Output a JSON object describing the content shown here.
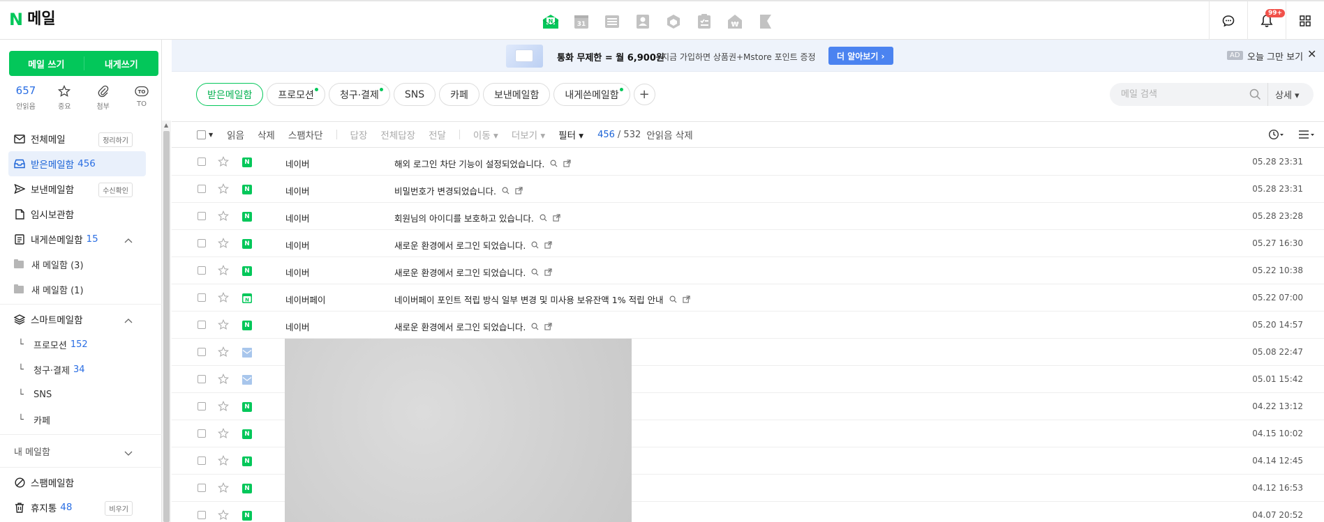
{
  "header": {
    "logo_mark": "N",
    "logo_text": "메일",
    "apps": [
      "mail-app",
      "calendar-app",
      "contacts-list-app",
      "address-book-app",
      "drive-box-app",
      "todo-app",
      "pay-app",
      "bookmark-app"
    ],
    "notification_badge": "99+",
    "calendar_day": "31"
  },
  "sidebar": {
    "write_mail": "메일 쓰기",
    "write_self": "내게쓰기",
    "quick": [
      {
        "value": "657",
        "label": "안읽음"
      },
      {
        "label": "중요"
      },
      {
        "label": "첨부"
      },
      {
        "label": "TO",
        "icon_text": "TO"
      }
    ],
    "items": [
      {
        "label": "전체메일",
        "tag": "정리하기"
      },
      {
        "label": "받은메일함",
        "count": "456"
      },
      {
        "label": "보낸메일함",
        "tag": "수신확인"
      },
      {
        "label": "임시보관함"
      },
      {
        "label": "내게쓴메일함",
        "count": "15"
      }
    ],
    "subfolders": [
      {
        "label": "새 메일함 (3)"
      },
      {
        "label": "새 메일함 (1)"
      }
    ],
    "smart": {
      "label": "스마트메일함",
      "children": [
        {
          "label": "프로모션",
          "count": "152"
        },
        {
          "label": "청구·결제",
          "count": "34"
        },
        {
          "label": "SNS"
        },
        {
          "label": "카페"
        }
      ]
    },
    "my_mailbox": "내 메일함",
    "spam": "스팸메일함",
    "trash": {
      "label": "휴지통",
      "count": "48",
      "tag": "비우기"
    }
  },
  "ad": {
    "title": "통화 무제한 = 월 6,900원",
    "subtitle": "지금 가입하면 상품권+Mstore 포인트 증정",
    "cta": "더 알아보기 ›",
    "tag": "AD",
    "dismiss": "오늘 그만 보기",
    "close": "✕"
  },
  "tabs": [
    {
      "label": "받은메일함"
    },
    {
      "label": "프로모션"
    },
    {
      "label": "청구·결제"
    },
    {
      "label": "SNS"
    },
    {
      "label": "카페"
    },
    {
      "label": "보낸메일함"
    },
    {
      "label": "내게쓴메일함"
    }
  ],
  "search": {
    "placeholder": "메일 검색",
    "detail": "상세 ▾"
  },
  "toolbar": {
    "read": "읽음",
    "delete": "삭제",
    "spam_block": "스팸차단",
    "reply": "답장",
    "reply_all": "전체답장",
    "forward": "전달",
    "move": "이동 ▾",
    "more": "더보기 ▾",
    "filter": "필터 ▾",
    "count_unread": "456",
    "count_total": "/ 532",
    "delete_unread": "안읽음 삭제"
  },
  "mails": [
    {
      "sender": "네이버",
      "subject": "해외 로그인 차단 기능이 설정되었습니다.",
      "date": "05.28 23:31",
      "icon": "naver"
    },
    {
      "sender": "네이버",
      "subject": "비밀번호가 변경되었습니다.",
      "date": "05.28 23:31",
      "icon": "naver"
    },
    {
      "sender": "네이버",
      "subject": "회원님의 아이디를 보호하고 있습니다.",
      "date": "05.28 23:28",
      "icon": "naver"
    },
    {
      "sender": "네이버",
      "subject": "새로운 환경에서 로그인 되었습니다.",
      "date": "05.27 16:30",
      "icon": "naver"
    },
    {
      "sender": "네이버",
      "subject": "새로운 환경에서 로그인 되었습니다.",
      "date": "05.22 10:38",
      "icon": "naver"
    },
    {
      "sender": "네이버페이",
      "subject": "네이버페이 포인트 적립 방식 일부 변경 및 미사용 보유잔액 1% 적립 안내",
      "date": "05.22 07:00",
      "icon": "pay"
    },
    {
      "sender": "네이버",
      "subject": "새로운 환경에서 로그인 되었습니다.",
      "date": "05.20 14:57",
      "icon": "naver"
    },
    {
      "sender": "",
      "subject": "",
      "date": "05.08 22:47",
      "icon": "envelope"
    },
    {
      "sender": "",
      "subject": "",
      "date": "05.01 15:42",
      "icon": "envelope"
    },
    {
      "sender": "",
      "subject": "",
      "date": "04.22 13:12",
      "icon": "naver"
    },
    {
      "sender": "",
      "subject": "",
      "date": "04.15 10:02",
      "icon": "naver"
    },
    {
      "sender": "",
      "subject": "",
      "date": "04.14 12:45",
      "icon": "naver"
    },
    {
      "sender": "",
      "subject": "",
      "date": "04.12 16:53",
      "icon": "naver"
    },
    {
      "sender": "",
      "subject": "",
      "date": "04.07 20:52",
      "icon": "naver"
    }
  ],
  "colors": {
    "brand": "#03c75a",
    "accent": "#1a62d6",
    "badge": "#f1514a"
  }
}
